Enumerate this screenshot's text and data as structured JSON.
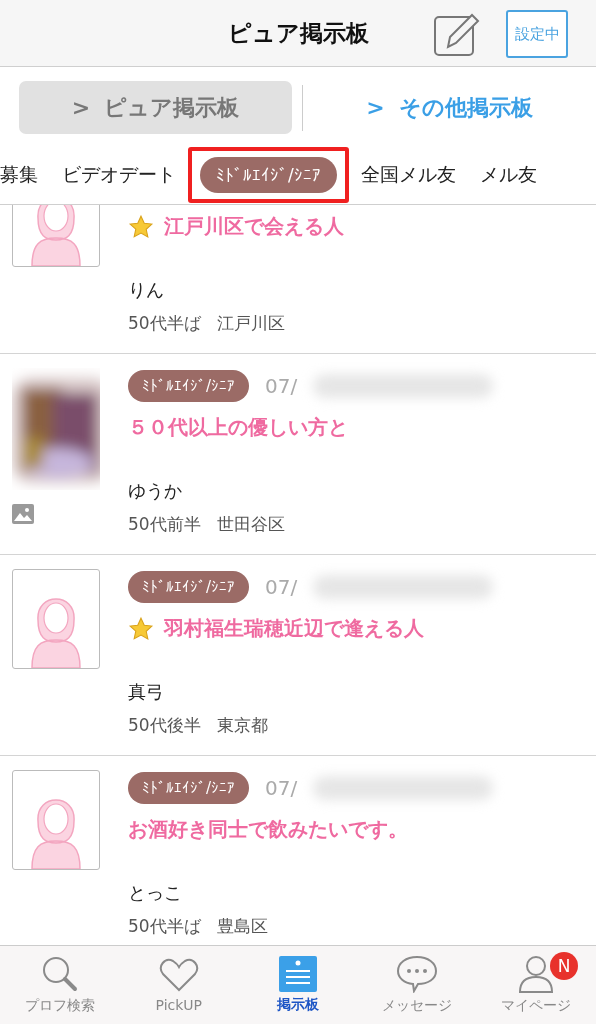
{
  "header": {
    "title": "ピュア掲示板",
    "status_badge": "設定中"
  },
  "board_switch": [
    {
      "chevron": ">",
      "label": "ピュア掲示板",
      "selected": true
    },
    {
      "chevron": ">",
      "label": "その他掲示板",
      "selected": false
    }
  ],
  "categories": [
    {
      "label": "募集",
      "selected": false,
      "annotated": false
    },
    {
      "label": "ビデオデート",
      "selected": false,
      "annotated": false
    },
    {
      "label": "ﾐﾄﾞﾙｴｲｼﾞ/ｼﾆｱ",
      "selected": true,
      "annotated": true
    },
    {
      "label": "全国メル友",
      "selected": false,
      "annotated": false
    },
    {
      "label": "メル友",
      "selected": false,
      "annotated": false
    }
  ],
  "posts": [
    {
      "kind": "silhouette",
      "starred": true,
      "title": "江戸川区で会える人",
      "name": "りん",
      "age": "50代半ば",
      "area": "江戸川区"
    },
    {
      "tag": "ﾐﾄﾞﾙｴｲｼﾞ/ｼﾆｱ",
      "date": "07/",
      "starred": false,
      "title": "５０代以上の優しい方と",
      "name": "ゆうか",
      "age": "50代前半",
      "area": "世田谷区"
    },
    {
      "kind": "silhouette",
      "tag": "ﾐﾄﾞﾙｴｲｼﾞ/ｼﾆｱ",
      "date": "07/",
      "starred": true,
      "title": "羽村福生瑞穂近辺で逢える人",
      "name": "真弓",
      "age": "50代後半",
      "area": "東京都"
    },
    {
      "kind": "silhouette",
      "tag": "ﾐﾄﾞﾙｴｲｼﾞ/ｼﾆｱ",
      "date": "07/",
      "starred": false,
      "title": "お酒好き同士で飲みたいです。",
      "name": "とっこ",
      "age": "50代半ば",
      "area": "豊島区"
    }
  ],
  "tab_bar": [
    {
      "kind": "search",
      "label": "プロフ検索",
      "selected": false
    },
    {
      "kind": "heart",
      "label": "PickUP",
      "selected": false
    },
    {
      "kind": "board",
      "label": "掲示板",
      "selected": true
    },
    {
      "kind": "message",
      "label": "メッセージ",
      "selected": false
    },
    {
      "kind": "person",
      "label": "マイページ",
      "selected": false,
      "badge": "N"
    }
  ]
}
